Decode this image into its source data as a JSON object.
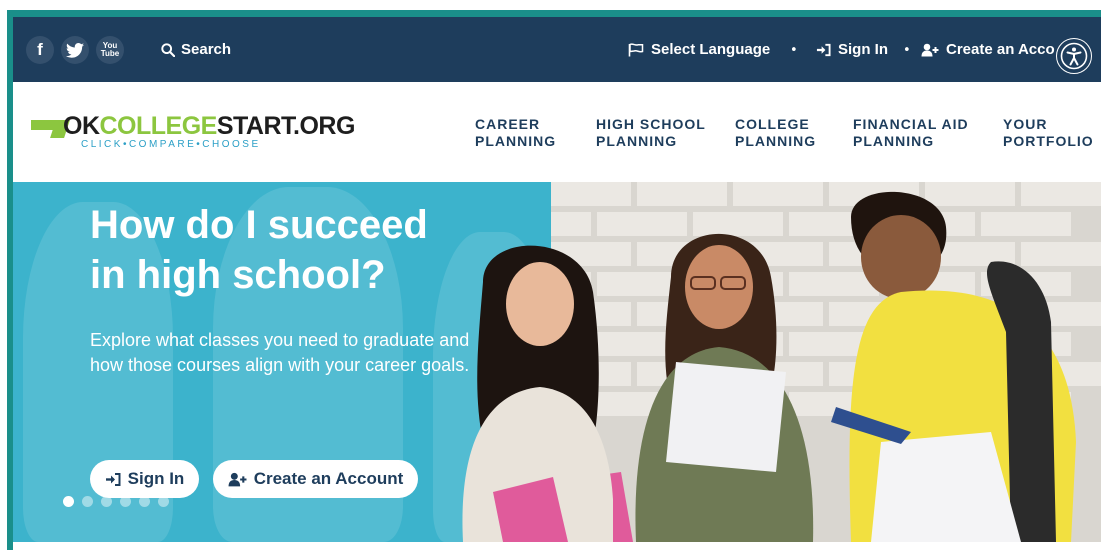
{
  "topbar": {
    "social": [
      {
        "name": "facebook",
        "glyph": "f"
      },
      {
        "name": "twitter",
        "glyph": ""
      },
      {
        "name": "youtube",
        "glyph_top": "You",
        "glyph_bottom": "Tube"
      }
    ],
    "search_label": "Search",
    "select_language_label": "Select Language",
    "sign_in_label": "Sign In",
    "create_account_label": "Create an Acco",
    "separator": "•"
  },
  "header": {
    "logo": {
      "ok": "OK",
      "college": "COLLEGE",
      "start": "START.ORG",
      "tagline": "CLICK•COMPARE•CHOOSE"
    },
    "nav": [
      {
        "line1": "CAREER",
        "line2": "PLANNING"
      },
      {
        "line1": "HIGH SCHOOL",
        "line2": "PLANNING"
      },
      {
        "line1": "COLLEGE",
        "line2": "PLANNING"
      },
      {
        "line1": "FINANCIAL AID",
        "line2": "PLANNING"
      },
      {
        "line1": "YOUR",
        "line2": "PORTFOLIO"
      }
    ]
  },
  "hero": {
    "title_line1": "How do I succeed",
    "title_line2": "in high school?",
    "description": "Explore what classes you need to graduate and how those courses align with your career goals.",
    "sign_in_button": "Sign In",
    "create_account_button": "Create an Account",
    "carousel": {
      "total": 6,
      "active": 1
    }
  },
  "colors": {
    "topbar_bg": "#1e3d5c",
    "frame": "#1a8f8a",
    "hero_overlay": "#3cb3cc",
    "logo_green": "#8cc63f",
    "logo_blue": "#2b9fc6",
    "nav_text": "#1e3d5c"
  }
}
